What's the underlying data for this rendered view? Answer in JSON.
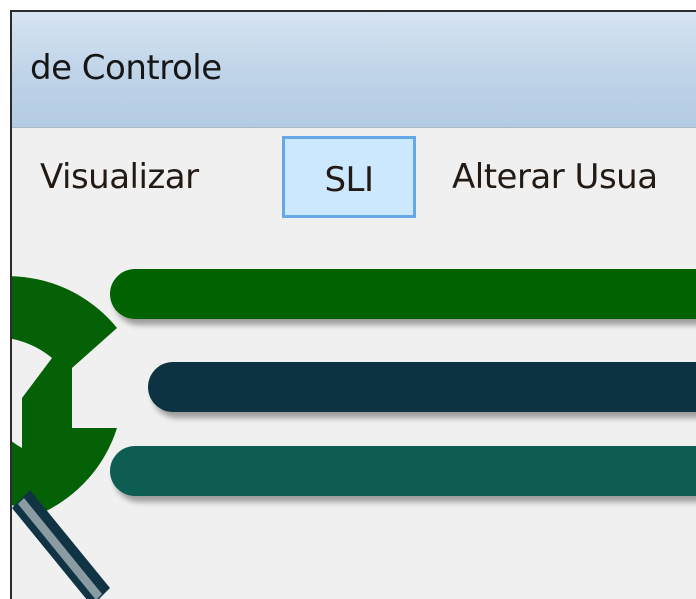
{
  "window": {
    "title": "de Controle"
  },
  "menu": {
    "items": [
      {
        "label": "Visualizar"
      },
      {
        "label": "SLI"
      },
      {
        "label": "Alterar Usua"
      }
    ]
  },
  "logo": {
    "icon": "magnifier-logo-icon",
    "colors": {
      "bar_top": "#066206",
      "bar_middle": "#0b3343",
      "bar_bottom": "#0a5d52",
      "lens": "#056105",
      "handle": "#103443"
    }
  }
}
